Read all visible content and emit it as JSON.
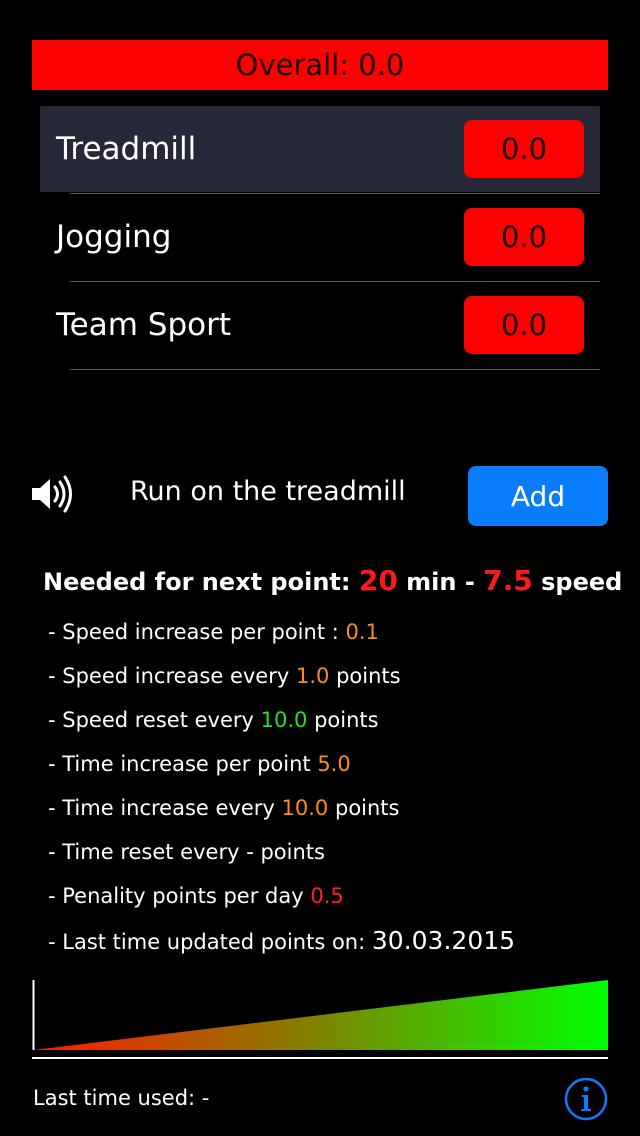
{
  "overall": {
    "label": "Overall: 0.0"
  },
  "activities": [
    {
      "name": "Treadmill",
      "score": "0.0",
      "selected": true
    },
    {
      "name": "Jogging",
      "score": "0.0",
      "selected": false
    },
    {
      "name": "Team Sport",
      "score": "0.0",
      "selected": false
    }
  ],
  "task": {
    "label": "Run on the treadmill",
    "add_label": "Add",
    "speaker_icon": "speaker-icon"
  },
  "needed": {
    "prefix": "Needed for next point:",
    "minutes": "20",
    "min_label": "min -",
    "speed": "7.5",
    "speed_label": "speed"
  },
  "rules": {
    "speed_inc_per_point": {
      "text": "- Speed increase per point :",
      "value": "0.1"
    },
    "speed_inc_every": {
      "text": "- Speed increase every",
      "value": "1.0",
      "suffix": "points"
    },
    "speed_reset_every": {
      "text": "- Speed reset every",
      "value": "10.0",
      "suffix": "points"
    },
    "time_inc_per_point": {
      "text": "- Time increase per point",
      "value": "5.0"
    },
    "time_inc_every": {
      "text": "- Time increase every",
      "value": "10.0",
      "suffix": "points"
    },
    "time_reset_every": {
      "text": "- Time reset every - points"
    },
    "penalty": {
      "text": "- Penality points per day",
      "value": "0.5"
    },
    "last_updated": {
      "text": "- Last time updated points on:",
      "value": "30.03.2015"
    }
  },
  "footer": {
    "last_used": "Last time used: -",
    "info_icon": "info-icon"
  },
  "colors": {
    "accent_red": "#ff0000",
    "accent_blue": "#0a7cff",
    "value_orange": "#ff8c1a",
    "value_green": "#22e322",
    "selected_row": "#262838"
  }
}
